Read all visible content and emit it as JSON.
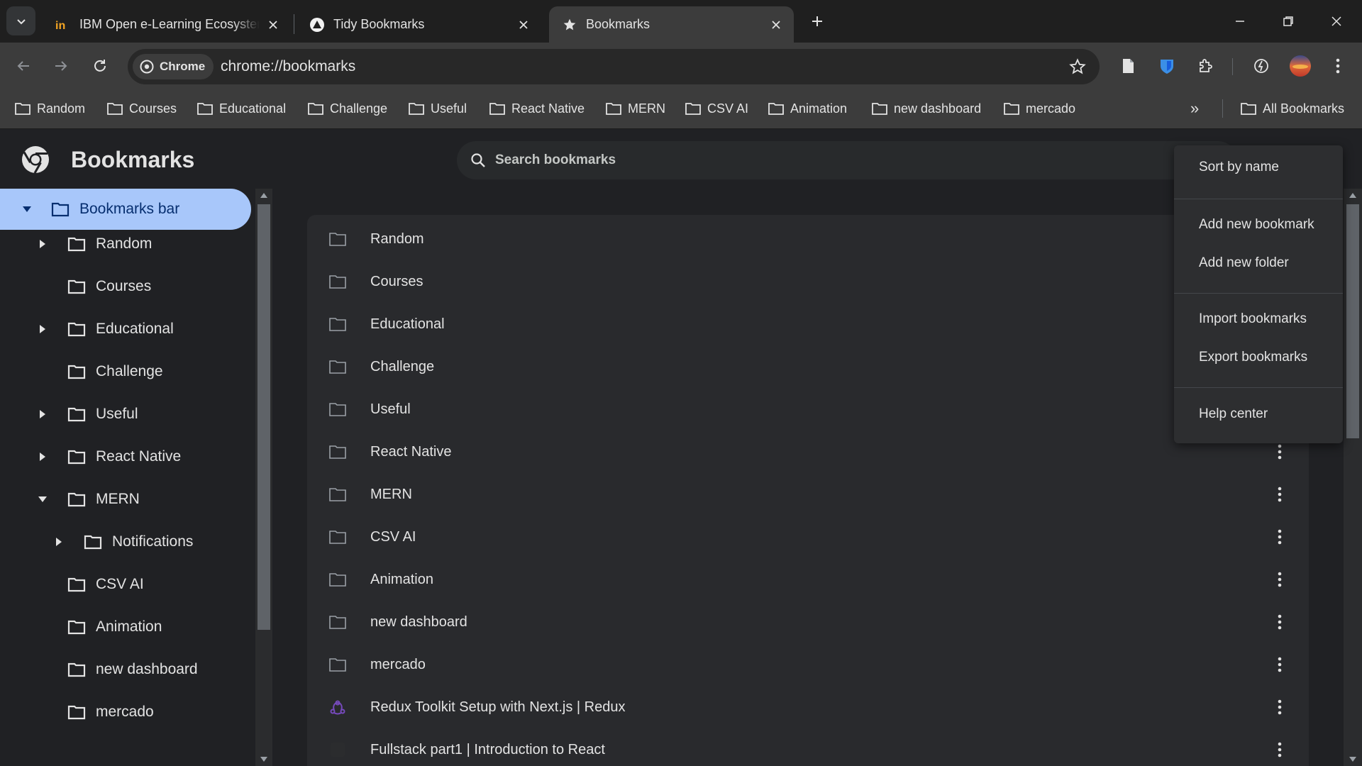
{
  "browser": {
    "tabs": [
      {
        "title": "IBM Open e-Learning Ecosystem",
        "favicon": "ibm-in-icon"
      },
      {
        "title": "Tidy Bookmarks",
        "favicon": "triangle-icon"
      },
      {
        "title": "Bookmarks",
        "favicon": "star-icon",
        "active": true
      }
    ],
    "omnibox": {
      "chip": "Chrome",
      "url": "chrome://bookmarks"
    }
  },
  "bookmarks_bar": {
    "items": [
      "Random",
      "Courses",
      "Educational",
      "Challenge",
      "Useful",
      "React Native",
      "MERN",
      "CSV AI",
      "Animation",
      "new dashboard",
      "mercado"
    ],
    "overflow": "»",
    "all_bookmarks": "All Bookmarks"
  },
  "page": {
    "title": "Bookmarks",
    "search_placeholder": "Search bookmarks"
  },
  "sidebar": {
    "items": [
      {
        "label": "Bookmarks bar",
        "expanded": true,
        "selected": true
      },
      {
        "label": "Random",
        "arrow": "collapsed"
      },
      {
        "label": "Courses"
      },
      {
        "label": "Educational",
        "arrow": "collapsed"
      },
      {
        "label": "Challenge"
      },
      {
        "label": "Useful",
        "arrow": "collapsed"
      },
      {
        "label": "React Native",
        "arrow": "collapsed"
      },
      {
        "label": "MERN",
        "arrow": "expanded"
      },
      {
        "label": "Notifications",
        "arrow": "collapsed"
      },
      {
        "label": "CSV AI"
      },
      {
        "label": "Animation"
      },
      {
        "label": "new dashboard"
      },
      {
        "label": "mercado"
      }
    ]
  },
  "list": {
    "rows": [
      {
        "label": "Random",
        "icon": "folder-icon"
      },
      {
        "label": "Courses",
        "icon": "folder-icon"
      },
      {
        "label": "Educational",
        "icon": "folder-icon"
      },
      {
        "label": "Challenge",
        "icon": "folder-icon"
      },
      {
        "label": "Useful",
        "icon": "folder-icon"
      },
      {
        "label": "React Native",
        "icon": "folder-icon"
      },
      {
        "label": "MERN",
        "icon": "folder-icon"
      },
      {
        "label": "CSV AI",
        "icon": "folder-icon"
      },
      {
        "label": "Animation",
        "icon": "folder-icon"
      },
      {
        "label": "new dashboard",
        "icon": "folder-icon"
      },
      {
        "label": "mercado",
        "icon": "folder-icon"
      },
      {
        "label": "Redux Toolkit Setup with Next.js | Redux",
        "icon": "redux-icon"
      },
      {
        "label": "Fullstack part1 | Introduction to React",
        "icon": "fullstack-icon"
      }
    ]
  },
  "menu": {
    "items": [
      "Sort by name",
      "Add new bookmark",
      "Add new folder",
      "Import bookmarks",
      "Export bookmarks",
      "Help center"
    ]
  },
  "colors": {
    "accent": "#a8c7fa",
    "background": "#202124",
    "card": "#292a2d",
    "redux": "#764abc"
  }
}
